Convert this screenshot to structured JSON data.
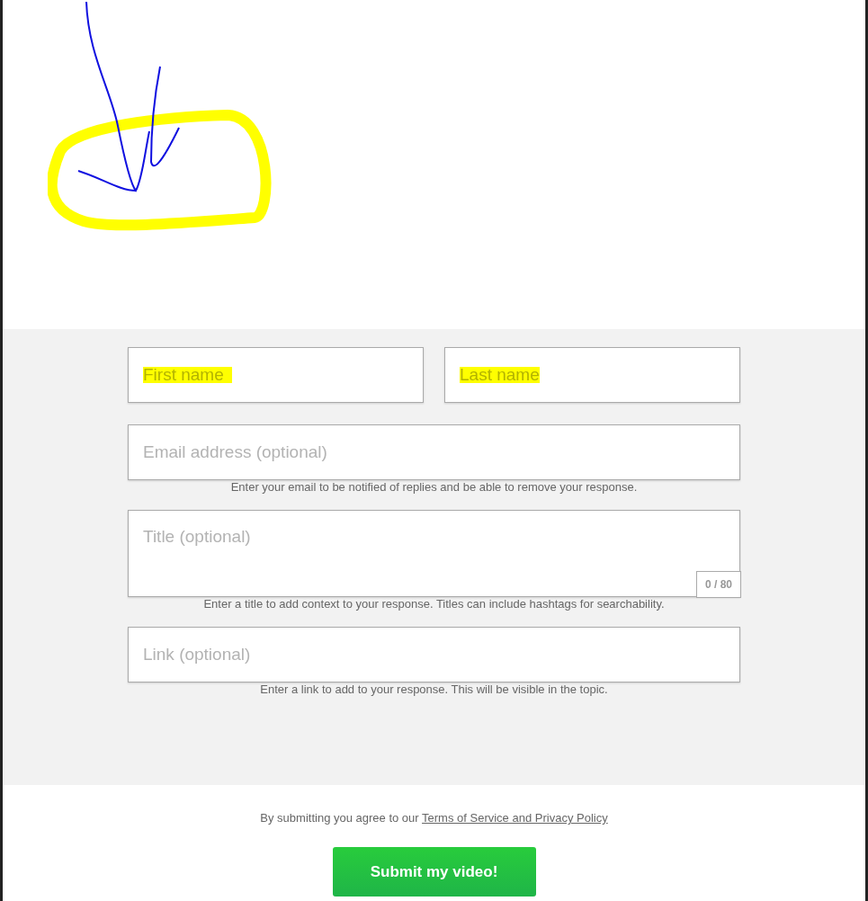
{
  "form": {
    "rows": [
      [
        {
          "kind": "input",
          "placeholder": "First name",
          "highlighted": true
        },
        {
          "kind": "input",
          "placeholder": "Last name",
          "highlighted": true
        }
      ],
      [
        {
          "kind": "input",
          "placeholder": "Email address (optional)",
          "highlighted": false,
          "help": "Enter your email to be notified of replies and be able to remove your response."
        }
      ],
      [
        {
          "kind": "textarea",
          "placeholder": "Title (optional)",
          "highlighted": false,
          "counter": "0 / 80",
          "help": "Enter a title to add context to your response. Titles can include hashtags for searchability."
        }
      ],
      [
        {
          "kind": "input",
          "placeholder": "Link (optional)",
          "highlighted": false,
          "help": "Enter a link to add to your response. This will be visible in the topic."
        }
      ]
    ]
  },
  "footer": {
    "agreement": "By submitting you agree to our",
    "agreement_link": "Terms of Service and Privacy Policy",
    "submit": "Submit my video!"
  }
}
